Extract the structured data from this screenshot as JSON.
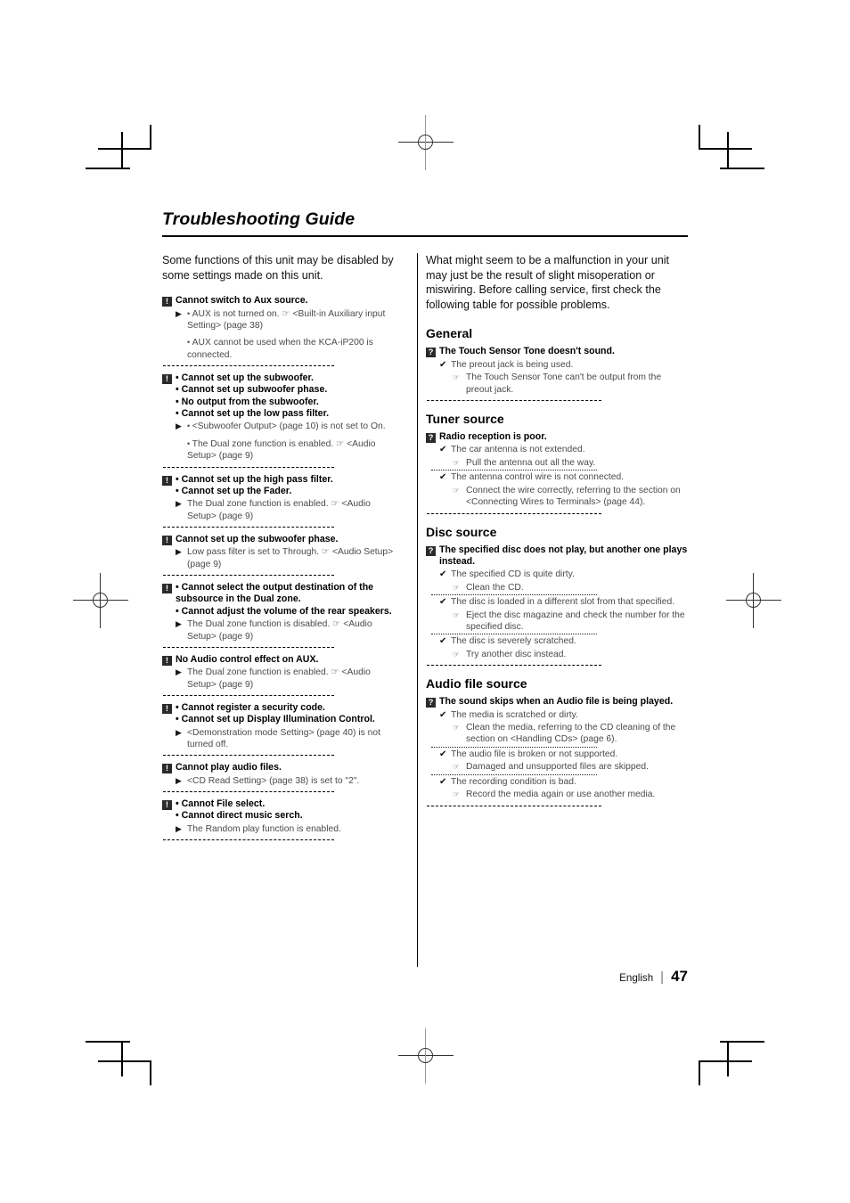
{
  "document": {
    "title": "Troubleshooting Guide",
    "footer": {
      "language": "English",
      "separator": "|",
      "page_number": "47"
    }
  },
  "icons": {
    "warning_badge": "exclamation-badge",
    "question_badge": "question-badge",
    "cause_marker": "check-mark",
    "remedy_marker": "pointing-hand",
    "arrow_marker": "solid-right-triangle"
  },
  "glyphs": {
    "warning": "!",
    "question": "?",
    "check": "✔",
    "hand": "☞",
    "arrow": "▶"
  },
  "left_column": {
    "intro": "Some functions of this unit may be disabled by some settings made on this unit.",
    "entries": [
      {
        "badge": "!",
        "head_lines": [
          "Cannot switch to Aux source."
        ],
        "bulleted_head": false,
        "rows": [
          {
            "type": "arrow-bullet",
            "text": "AUX is not turned on. ☞ <Built-in Auxiliary input Setting> (page 38)"
          },
          {
            "type": "bullet-only",
            "text": "AUX cannot be used when the KCA-iP200 is connected."
          }
        ]
      },
      {
        "badge": "!",
        "head_lines": [
          "Cannot set up the subwoofer.",
          "Cannot set up subwoofer phase.",
          "No output from the subwoofer.",
          "Cannot set up the low pass filter."
        ],
        "bulleted_head": true,
        "rows": [
          {
            "type": "arrow-bullet",
            "text": "<Subwoofer Output> (page 10) is not set to On."
          },
          {
            "type": "bullet-only",
            "text": "The Dual zone function is enabled. ☞ <Audio Setup> (page 9)"
          }
        ]
      },
      {
        "badge": "!",
        "head_lines": [
          "Cannot set up the high pass filter.",
          "Cannot set up the Fader."
        ],
        "bulleted_head": true,
        "rows": [
          {
            "type": "arrow",
            "text": "The Dual zone function is enabled. ☞ <Audio Setup> (page 9)"
          }
        ]
      },
      {
        "badge": "!",
        "head_lines": [
          "Cannot set up the subwoofer phase."
        ],
        "bulleted_head": false,
        "rows": [
          {
            "type": "arrow",
            "text": "Low pass filter is set to Through. ☞ <Audio Setup> (page 9)"
          }
        ]
      },
      {
        "badge": "!",
        "head_lines": [
          "Cannot select the output destination of the subsource in the Dual zone.",
          "Cannot adjust the volume of the rear speakers."
        ],
        "bulleted_head": true,
        "rows": [
          {
            "type": "arrow",
            "text": "The Dual zone function is disabled. ☞ <Audio Setup> (page 9)"
          }
        ]
      },
      {
        "badge": "!",
        "head_lines": [
          "No Audio control effect on AUX."
        ],
        "bulleted_head": false,
        "rows": [
          {
            "type": "arrow",
            "text": "The Dual zone function is enabled. ☞ <Audio Setup> (page 9)"
          }
        ]
      },
      {
        "badge": "!",
        "head_lines": [
          "Cannot register a security code.",
          "Cannot set up Display Illumination Control."
        ],
        "bulleted_head": true,
        "rows": [
          {
            "type": "arrow",
            "text": "<Demonstration mode Setting> (page 40) is not turned off."
          }
        ]
      },
      {
        "badge": "!",
        "head_lines": [
          "Cannot play audio files."
        ],
        "bulleted_head": false,
        "rows": [
          {
            "type": "arrow",
            "text": "<CD Read Setting> (page 38) is set to \"2\"."
          }
        ]
      },
      {
        "badge": "!",
        "head_lines": [
          "Cannot File select.",
          "Cannot direct music serch."
        ],
        "bulleted_head": true,
        "rows": [
          {
            "type": "arrow",
            "text": "The Random play function is enabled."
          }
        ]
      }
    ]
  },
  "right_column": {
    "intro": "What might seem to be a malfunction in your unit may just be the result of slight misoperation or miswiring. Before calling service, first check the following table for possible problems.",
    "sections": [
      {
        "heading": "General",
        "entries": [
          {
            "badge": "?",
            "head_lines": [
              "The Touch Sensor Tone doesn't sound."
            ],
            "rows": [
              {
                "type": "check",
                "text": "The preout jack is being used."
              },
              {
                "type": "hand",
                "text": "The Touch Sensor Tone can't be output from the preout jack."
              }
            ]
          }
        ]
      },
      {
        "heading": "Tuner source",
        "entries": [
          {
            "badge": "?",
            "head_lines": [
              "Radio reception is poor."
            ],
            "rows": [
              {
                "type": "check",
                "text": "The car antenna is not extended."
              },
              {
                "type": "hand",
                "text": "Pull the antenna out all the way."
              },
              {
                "type": "dotted-separator",
                "text": ""
              },
              {
                "type": "check",
                "text": "The antenna control wire is not connected."
              },
              {
                "type": "hand",
                "text": "Connect the wire correctly, referring to the section on <Connecting Wires to Terminals> (page 44)."
              }
            ]
          }
        ]
      },
      {
        "heading": "Disc source",
        "entries": [
          {
            "badge": "?",
            "head_lines": [
              "The specified disc does not play, but another one plays instead."
            ],
            "rows": [
              {
                "type": "check",
                "text": "The specified CD is quite dirty."
              },
              {
                "type": "hand",
                "text": "Clean the CD."
              },
              {
                "type": "dotted-separator",
                "text": ""
              },
              {
                "type": "check",
                "text": "The disc is loaded in a different slot from that specified."
              },
              {
                "type": "hand",
                "text": "Eject the disc magazine and check the number for the specified disc."
              },
              {
                "type": "dotted-separator",
                "text": ""
              },
              {
                "type": "check",
                "text": "The disc is severely scratched."
              },
              {
                "type": "hand",
                "text": "Try another disc instead."
              }
            ]
          }
        ]
      },
      {
        "heading": "Audio file source",
        "entries": [
          {
            "badge": "?",
            "head_lines": [
              "The sound skips when an Audio file is being played."
            ],
            "rows": [
              {
                "type": "check",
                "text": "The media is scratched or dirty."
              },
              {
                "type": "hand",
                "text": "Clean the media, referring to the CD cleaning of the section on <Handling CDs> (page 6)."
              },
              {
                "type": "dotted-separator",
                "text": ""
              },
              {
                "type": "check",
                "text": "The audio file is broken or not supported."
              },
              {
                "type": "hand",
                "text": "Damaged and unsupported files are skipped."
              },
              {
                "type": "dotted-separator",
                "text": ""
              },
              {
                "type": "check",
                "text": "The recording condition is bad."
              },
              {
                "type": "hand",
                "text": "Record the media again or use another media."
              }
            ]
          }
        ]
      }
    ]
  }
}
